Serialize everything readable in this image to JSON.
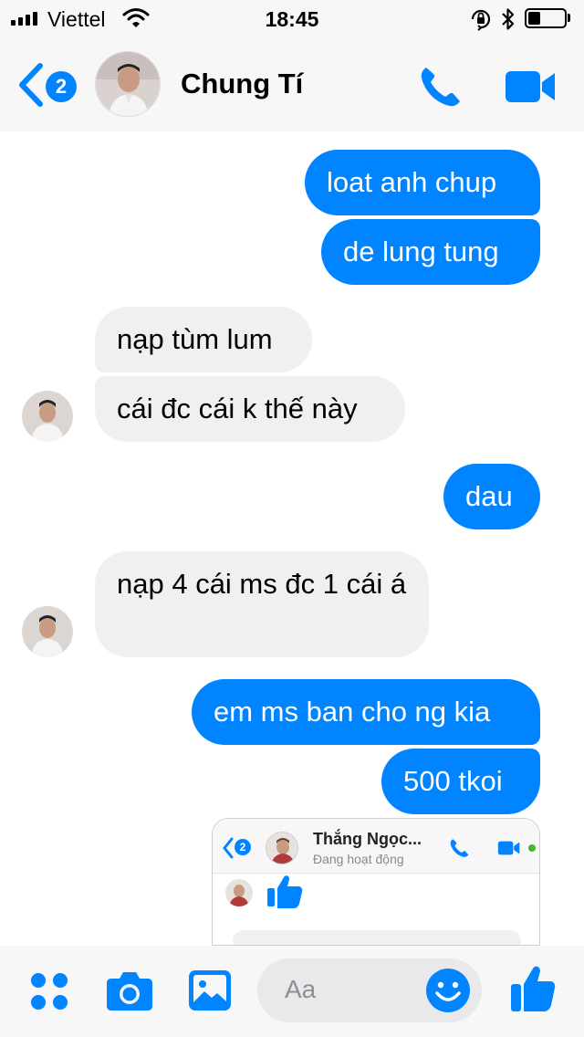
{
  "status_bar": {
    "carrier": "Viettel",
    "time": "18:45",
    "signal_bars": 4,
    "battery_level": 0.35
  },
  "header": {
    "unread_count": "2",
    "contact_name": "Chung Tí",
    "icons": [
      "back-chevron-icon",
      "phone-icon",
      "video-camera-icon"
    ]
  },
  "messages": [
    {
      "side": "out",
      "text": "loat anh chup"
    },
    {
      "side": "out",
      "text": "de lung tung"
    },
    {
      "side": "in",
      "text": "nạp tùm lum"
    },
    {
      "side": "in",
      "text": "cái đc cái k thế này"
    },
    {
      "side": "out",
      "text": "dau"
    },
    {
      "side": "in",
      "text": "nạp 4 cái ms đc 1 cái á"
    },
    {
      "side": "out",
      "text": "em ms ban cho ng kia"
    },
    {
      "side": "out",
      "text": "500 tkoi"
    }
  ],
  "shared_screenshot": {
    "unread_count": "2",
    "contact_name": "Thắng Ngọc...",
    "status": "Đang hoạt động"
  },
  "composer": {
    "placeholder": "Aa",
    "icons": [
      "apps-grid-icon",
      "camera-icon",
      "photo-icon",
      "emoji-icon",
      "thumbs-up-icon"
    ]
  },
  "colors": {
    "accent": "#0084ff",
    "incoming_bubble": "#f1f0f0",
    "bar_background": "#f7f7f7"
  }
}
